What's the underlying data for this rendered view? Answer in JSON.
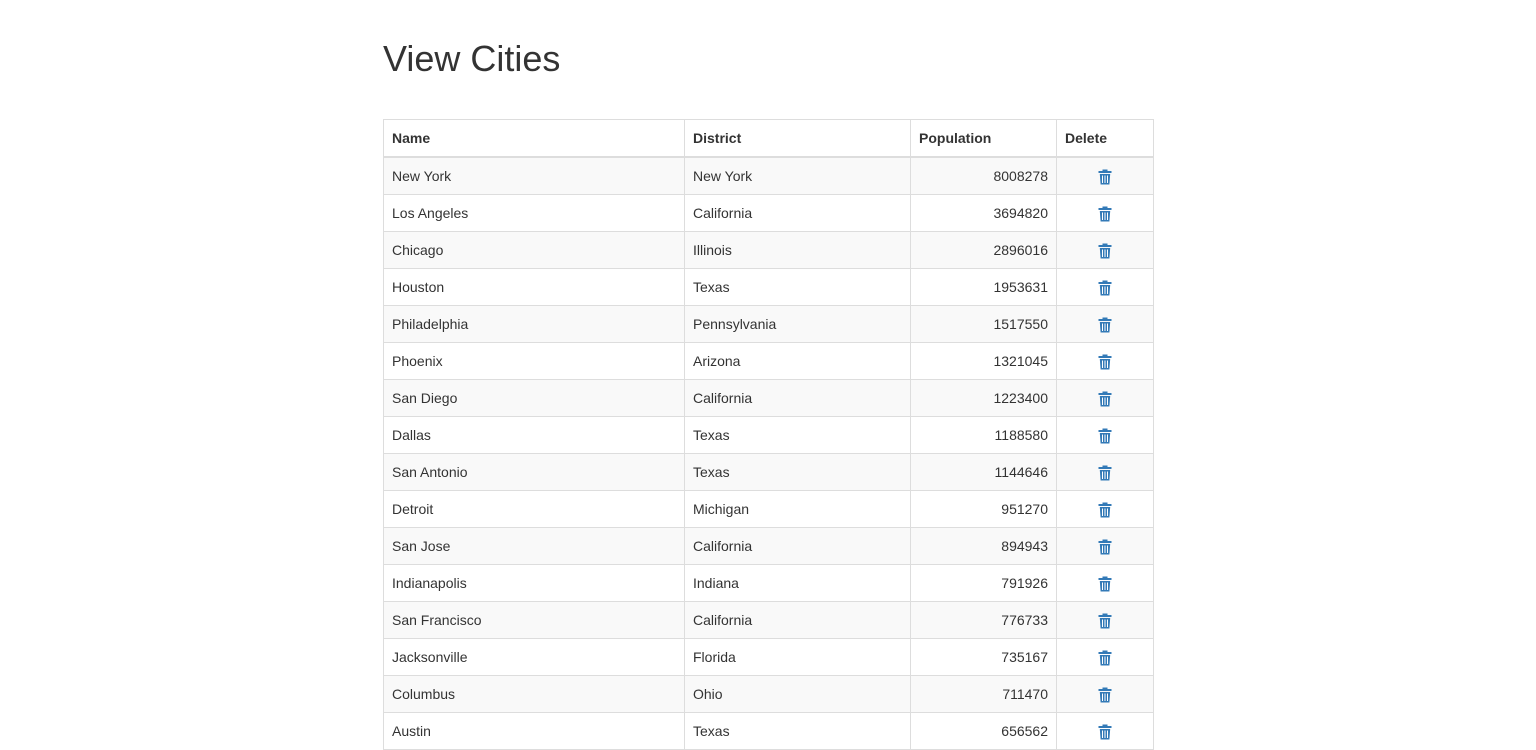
{
  "page": {
    "title": "View Cities"
  },
  "table": {
    "headers": {
      "name": "Name",
      "district": "District",
      "population": "Population",
      "delete": "Delete"
    },
    "rows": [
      {
        "name": "New York",
        "district": "New York",
        "population": "8008278"
      },
      {
        "name": "Los Angeles",
        "district": "California",
        "population": "3694820"
      },
      {
        "name": "Chicago",
        "district": "Illinois",
        "population": "2896016"
      },
      {
        "name": "Houston",
        "district": "Texas",
        "population": "1953631"
      },
      {
        "name": "Philadelphia",
        "district": "Pennsylvania",
        "population": "1517550"
      },
      {
        "name": "Phoenix",
        "district": "Arizona",
        "population": "1321045"
      },
      {
        "name": "San Diego",
        "district": "California",
        "population": "1223400"
      },
      {
        "name": "Dallas",
        "district": "Texas",
        "population": "1188580"
      },
      {
        "name": "San Antonio",
        "district": "Texas",
        "population": "1144646"
      },
      {
        "name": "Detroit",
        "district": "Michigan",
        "population": "951270"
      },
      {
        "name": "San Jose",
        "district": "California",
        "population": "894943"
      },
      {
        "name": "Indianapolis",
        "district": "Indiana",
        "population": "791926"
      },
      {
        "name": "San Francisco",
        "district": "California",
        "population": "776733"
      },
      {
        "name": "Jacksonville",
        "district": "Florida",
        "population": "735167"
      },
      {
        "name": "Columbus",
        "district": "Ohio",
        "population": "711470"
      },
      {
        "name": "Austin",
        "district": "Texas",
        "population": "656562"
      }
    ],
    "delete_icon": "trash-icon"
  },
  "colors": {
    "text": "#333333",
    "border": "#dddddd",
    "stripe": "#f9f9f9",
    "icon": "#337ab7"
  }
}
